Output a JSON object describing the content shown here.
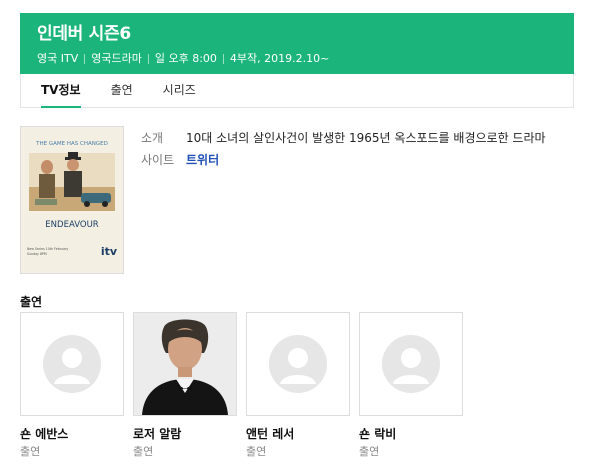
{
  "header": {
    "title": "인데버 시즌6",
    "meta": [
      "영국 ITV",
      "영국드라마",
      "일 오후 8:00",
      "4부작, 2019.2.10~"
    ],
    "bg_color": "#1bb57b"
  },
  "tabs": [
    {
      "label": "TV정보",
      "active": true
    },
    {
      "label": "출연",
      "active": false
    },
    {
      "label": "시리즈",
      "active": false
    }
  ],
  "poster": {
    "tagline": "THE GAME HAS CHANGED",
    "title": "ENDEAVOUR",
    "network": "itv",
    "small_text_1": "New Series 10th February",
    "small_text_2": "Sunday 8PM"
  },
  "info": {
    "synopsis_label": "소개",
    "synopsis_value": "10대 소녀의 살인사건이 발생한 1965년 옥스포드를 배경으로한 드라마",
    "site_label": "사이트",
    "site_value": "트위터"
  },
  "cast_section_title": "출연",
  "cast": [
    {
      "name": "숀 에반스",
      "role": "출연",
      "photo": "placeholder"
    },
    {
      "name": "로저 알람",
      "role": "출연",
      "photo": "portrait"
    },
    {
      "name": "앤턴 레서",
      "role": "출연",
      "photo": "placeholder"
    },
    {
      "name": "숀 락비",
      "role": "출연",
      "photo": "placeholder"
    }
  ]
}
